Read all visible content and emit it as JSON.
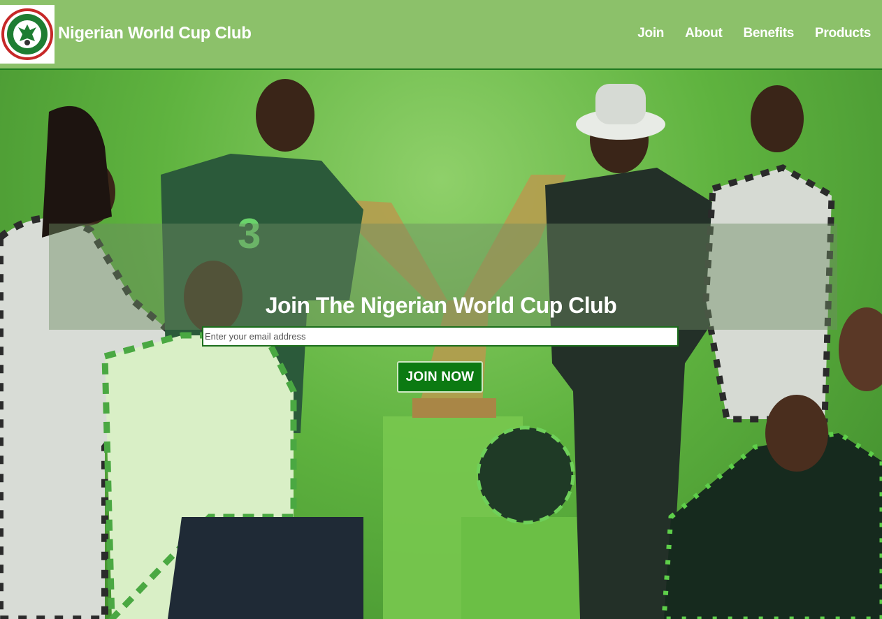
{
  "header": {
    "logo_alt": "NIGERIA FOOTBALL FEDERATION",
    "title": "Nigerian World Cup Club",
    "nav": [
      {
        "label": "Join"
      },
      {
        "label": "About"
      },
      {
        "label": "Benefits"
      },
      {
        "label": "Products"
      }
    ]
  },
  "hero": {
    "heading": "Join The Nigerian World Cup Club",
    "email_placeholder": "Enter your email address",
    "email_value": "",
    "button_label": "JOIN NOW"
  },
  "colors": {
    "header_bg": "#8cc16a",
    "header_border": "#1f7a1f",
    "button_bg": "#0c7a12",
    "hero_green": "#5fb33f"
  }
}
